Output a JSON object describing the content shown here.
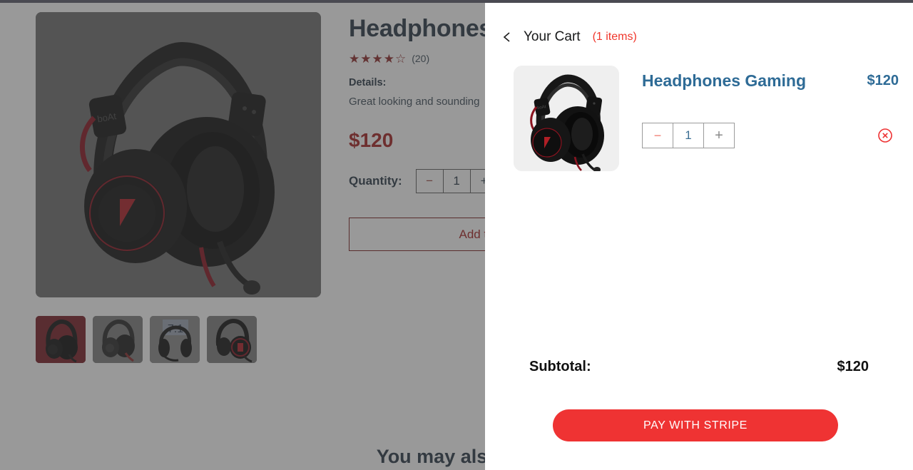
{
  "product": {
    "title": "Headphones Gaming",
    "title_visible": "Headphones",
    "rating_stars": "★★★★☆",
    "rating_count": "(20)",
    "details_label": "Details:",
    "details_text": "Great looking and sounding",
    "price": "$120",
    "quantity_label": "Quantity:",
    "quantity_value": "1",
    "minus_label": "−",
    "plus_label": "+",
    "add_to_cart_label": "Add to Cart",
    "thumbnails": [
      {
        "name": "thumb-1",
        "active": true
      },
      {
        "name": "thumb-2",
        "active": false
      },
      {
        "name": "thumb-3",
        "active": false
      },
      {
        "name": "thumb-4",
        "active": false
      }
    ]
  },
  "suggestions": {
    "heading": "You may also like"
  },
  "cart": {
    "back_icon": "chevron-left-icon",
    "title": "Your Cart",
    "count_label": "(1 items)",
    "items": [
      {
        "name": "Headphones Gaming",
        "price": "$120",
        "quantity": "1",
        "minus_label": "−",
        "plus_label": "+",
        "remove_icon": "circle-x-icon"
      }
    ],
    "subtotal_label": "Subtotal:",
    "subtotal_value": "$120",
    "pay_button_label": "PAY WITH STRIPE"
  },
  "colors": {
    "accent_red": "#ef3333",
    "brand_red": "#a52222",
    "steel_blue": "#2e6b96",
    "overlay": "rgba(60,60,60,0.52)"
  }
}
